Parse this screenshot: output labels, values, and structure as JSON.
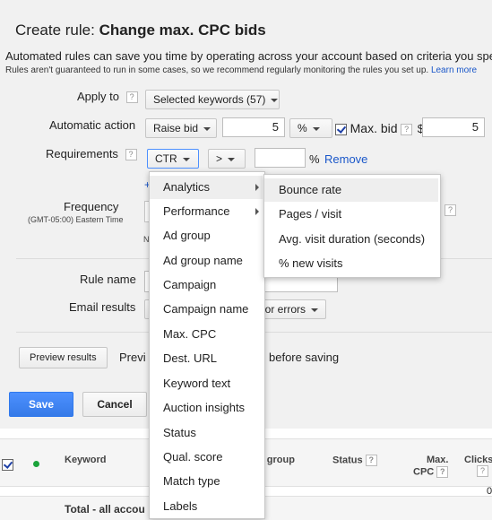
{
  "title": {
    "prefix": "Create rule:",
    "name": "Change max. CPC bids"
  },
  "intro": "Automated rules can save you time by operating across your account based on criteria you spe",
  "note": {
    "text": "Rules aren't guaranteed to run in some cases, so we recommend regularly monitoring the rules you set up.",
    "link": "Learn more"
  },
  "help_glyph": "?",
  "apply_to": {
    "label": "Apply to",
    "value": "Selected keywords (57)"
  },
  "automatic_action": {
    "label": "Automatic action",
    "action": "Raise bid",
    "amount": "5",
    "unit": "%",
    "max_bid_label": "Max. bid",
    "max_bid_checked": true,
    "currency": "$",
    "max_bid_value": "5"
  },
  "requirements": {
    "label": "Requirements",
    "metric": "CTR",
    "operator": ">",
    "value": "",
    "unit": "%",
    "remove": "Remove"
  },
  "frequency": {
    "label": "Frequency",
    "timezone": "(GMT-05:00) Eastern Time",
    "fragment": "N"
  },
  "rule_name": {
    "label": "Rule name",
    "value": ""
  },
  "email_results": {
    "label": "Email results",
    "value": "or errors"
  },
  "preview": {
    "button": "Preview results",
    "text_start": "Previ",
    "text_end": "before saving"
  },
  "save_label": "Save",
  "cancel_label": "Cancel",
  "add_glyph": "+",
  "table": {
    "headers": {
      "keyword": "Keyword",
      "ad_group": "d group",
      "status": "Status",
      "max_cpc_1": "Max.",
      "max_cpc_2": "CPC",
      "clicks": "Clicks"
    },
    "zero_value": "0",
    "total_label": "Total - all accou"
  },
  "metric_menu": {
    "items": [
      {
        "label": "Analytics",
        "submenu": true,
        "highlight": true
      },
      {
        "label": "Performance",
        "submenu": true
      },
      {
        "label": "Ad group"
      },
      {
        "label": "Ad group name"
      },
      {
        "label": "Campaign"
      },
      {
        "label": "Campaign name"
      },
      {
        "label": "Max. CPC"
      },
      {
        "label": "Dest. URL"
      },
      {
        "label": "Keyword text"
      },
      {
        "label": "Auction insights"
      },
      {
        "label": "Status"
      },
      {
        "label": "Qual. score"
      },
      {
        "label": "Match type"
      },
      {
        "label": "Labels"
      }
    ]
  },
  "analytics_submenu": {
    "items": [
      {
        "label": "Bounce rate",
        "highlight": true
      },
      {
        "label": "Pages / visit"
      },
      {
        "label": "Avg. visit duration (seconds)"
      },
      {
        "label": "% new visits"
      }
    ]
  },
  "colors": {
    "link": "#1a57c9",
    "primary_button": "#4d90fe",
    "active_dot": "#1aa33a",
    "highlight": "#eeeeee"
  }
}
